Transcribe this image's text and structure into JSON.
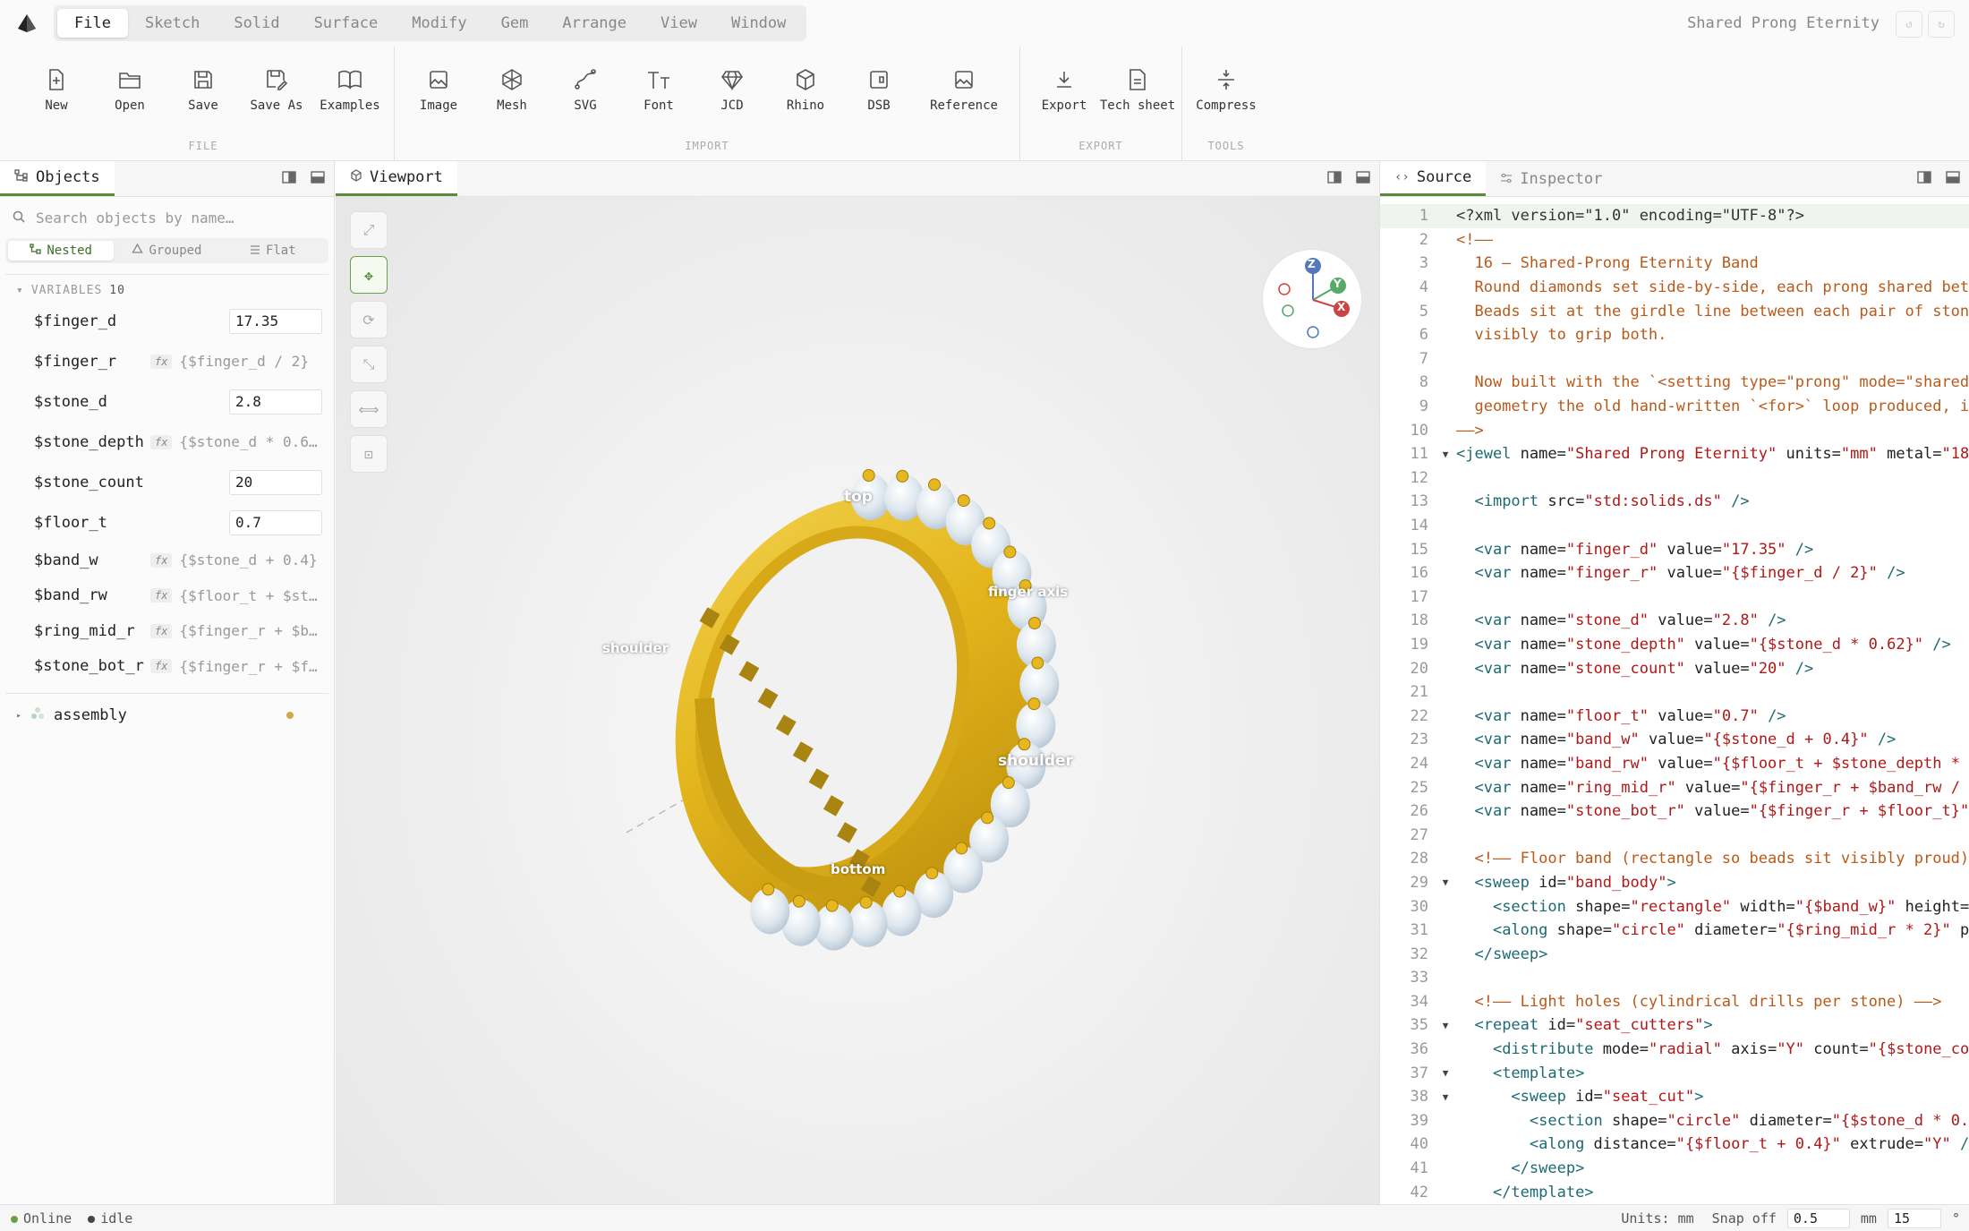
{
  "app": {
    "document_title": "Shared Prong Eternity"
  },
  "menu": [
    "File",
    "Sketch",
    "Solid",
    "Surface",
    "Modify",
    "Gem",
    "Arrange",
    "View",
    "Window"
  ],
  "ribbon": {
    "file": {
      "label": "FILE",
      "tools": [
        "New",
        "Open",
        "Save",
        "Save As",
        "Examples"
      ]
    },
    "import": {
      "label": "IMPORT",
      "tools": [
        "Image",
        "Mesh",
        "SVG",
        "Font",
        "JCD",
        "Rhino",
        "DSB",
        "Reference"
      ]
    },
    "export": {
      "label": "EXPORT",
      "tools": [
        "Export",
        "Tech sheet"
      ]
    },
    "tools": {
      "label": "TOOLS",
      "tools": [
        "Compress"
      ]
    }
  },
  "left_panel": {
    "tab": "Objects",
    "search_placeholder": "Search objects by name…",
    "view_tabs": [
      "Nested",
      "Grouped",
      "Flat"
    ],
    "variables_label": "VARIABLES",
    "variables_count": "10",
    "variables": [
      {
        "name": "$finger_d",
        "value": "17.35",
        "kind": "value"
      },
      {
        "name": "$finger_r",
        "value": "{$finger_d / 2}",
        "kind": "expr"
      },
      {
        "name": "$stone_d",
        "value": "2.8",
        "kind": "value"
      },
      {
        "name": "$stone_depth",
        "value": "{$stone_d * 0.6…",
        "kind": "expr"
      },
      {
        "name": "$stone_count",
        "value": "20",
        "kind": "value"
      },
      {
        "name": "$floor_t",
        "value": "0.7",
        "kind": "value"
      },
      {
        "name": "$band_w",
        "value": "{$stone_d + 0.4}",
        "kind": "expr"
      },
      {
        "name": "$band_rw",
        "value": "{$floor_t + $st…",
        "kind": "expr"
      },
      {
        "name": "$ring_mid_r",
        "value": "{$finger_r + $b…",
        "kind": "expr"
      },
      {
        "name": "$stone_bot_r",
        "value": "{$finger_r + $f…",
        "kind": "expr"
      }
    ],
    "tree": [
      {
        "label": "assembly"
      }
    ]
  },
  "viewport": {
    "tab": "Viewport",
    "labels": {
      "top": "top",
      "finger_axis": "finger axis",
      "shoulder_left": "shoulder",
      "shoulder_right": "shoulder",
      "bottom": "bottom"
    },
    "gizmo": {
      "z": "Z",
      "y": "Y",
      "x": "X"
    }
  },
  "right_panel": {
    "tabs": [
      "Source",
      "Inspector"
    ]
  },
  "source_lines": [
    [
      [
        "pi",
        "<?xml version=\"1.0\" encoding=\"UTF-8\"?>"
      ]
    ],
    [
      [
        "com",
        "<!——"
      ]
    ],
    [
      [
        "com",
        "  16 — Shared-Prong Eternity Band"
      ]
    ],
    [
      [
        "com",
        "  Round diamonds set side-by-side, each prong shared bet"
      ]
    ],
    [
      [
        "com",
        "  Beads sit at the girdle line between each pair of ston"
      ]
    ],
    [
      [
        "com",
        "  visibly to grip both."
      ]
    ],
    [],
    [
      [
        "com",
        "  Now built with the `<setting type=\"prong\" mode=\"shared"
      ]
    ],
    [
      [
        "com",
        "  geometry the old hand-written `<for>` loop produced, i"
      ]
    ],
    [
      [
        "com",
        "——>"
      ]
    ],
    [
      [
        "tag",
        "<jewel"
      ],
      [
        "attr",
        " name="
      ],
      [
        "str",
        "\"Shared Prong Eternity\""
      ],
      [
        "attr",
        " units="
      ],
      [
        "str",
        "\"mm\""
      ],
      [
        "attr",
        " metal="
      ],
      [
        "str",
        "\"18"
      ]
    ],
    [],
    [
      [
        "txt",
        "  "
      ],
      [
        "tag",
        "<import"
      ],
      [
        "attr",
        " src="
      ],
      [
        "str",
        "\"std:solids.ds\""
      ],
      [
        "tag",
        " />"
      ]
    ],
    [],
    [
      [
        "txt",
        "  "
      ],
      [
        "tag",
        "<var"
      ],
      [
        "attr",
        " name="
      ],
      [
        "str",
        "\"finger_d\""
      ],
      [
        "attr",
        " value="
      ],
      [
        "str",
        "\"17.35\""
      ],
      [
        "tag",
        " />"
      ]
    ],
    [
      [
        "txt",
        "  "
      ],
      [
        "tag",
        "<var"
      ],
      [
        "attr",
        " name="
      ],
      [
        "str",
        "\"finger_r\""
      ],
      [
        "attr",
        " value="
      ],
      [
        "str",
        "\"{$finger_d / 2}\""
      ],
      [
        "tag",
        " />"
      ]
    ],
    [],
    [
      [
        "txt",
        "  "
      ],
      [
        "tag",
        "<var"
      ],
      [
        "attr",
        " name="
      ],
      [
        "str",
        "\"stone_d\""
      ],
      [
        "attr",
        " value="
      ],
      [
        "str",
        "\"2.8\""
      ],
      [
        "tag",
        " />"
      ]
    ],
    [
      [
        "txt",
        "  "
      ],
      [
        "tag",
        "<var"
      ],
      [
        "attr",
        " name="
      ],
      [
        "str",
        "\"stone_depth\""
      ],
      [
        "attr",
        " value="
      ],
      [
        "str",
        "\"{$stone_d * 0.62}\""
      ],
      [
        "tag",
        " />"
      ]
    ],
    [
      [
        "txt",
        "  "
      ],
      [
        "tag",
        "<var"
      ],
      [
        "attr",
        " name="
      ],
      [
        "str",
        "\"stone_count\""
      ],
      [
        "attr",
        " value="
      ],
      [
        "str",
        "\"20\""
      ],
      [
        "tag",
        " />"
      ]
    ],
    [],
    [
      [
        "txt",
        "  "
      ],
      [
        "tag",
        "<var"
      ],
      [
        "attr",
        " name="
      ],
      [
        "str",
        "\"floor_t\""
      ],
      [
        "attr",
        " value="
      ],
      [
        "str",
        "\"0.7\""
      ],
      [
        "tag",
        " />"
      ]
    ],
    [
      [
        "txt",
        "  "
      ],
      [
        "tag",
        "<var"
      ],
      [
        "attr",
        " name="
      ],
      [
        "str",
        "\"band_w\""
      ],
      [
        "attr",
        " value="
      ],
      [
        "str",
        "\"{$stone_d + 0.4}\""
      ],
      [
        "tag",
        " />"
      ]
    ],
    [
      [
        "txt",
        "  "
      ],
      [
        "tag",
        "<var"
      ],
      [
        "attr",
        " name="
      ],
      [
        "str",
        "\"band_rw\""
      ],
      [
        "attr",
        " value="
      ],
      [
        "str",
        "\"{$floor_t + $stone_depth *"
      ]
    ],
    [
      [
        "txt",
        "  "
      ],
      [
        "tag",
        "<var"
      ],
      [
        "attr",
        " name="
      ],
      [
        "str",
        "\"ring_mid_r\""
      ],
      [
        "attr",
        " value="
      ],
      [
        "str",
        "\"{$finger_r + $band_rw /"
      ]
    ],
    [
      [
        "txt",
        "  "
      ],
      [
        "tag",
        "<var"
      ],
      [
        "attr",
        " name="
      ],
      [
        "str",
        "\"stone_bot_r\""
      ],
      [
        "attr",
        " value="
      ],
      [
        "str",
        "\"{$finger_r + $floor_t}\""
      ]
    ],
    [],
    [
      [
        "com",
        "  <!—— Floor band (rectangle so beads sit visibly proud)"
      ]
    ],
    [
      [
        "txt",
        "  "
      ],
      [
        "tag",
        "<sweep"
      ],
      [
        "attr",
        " id="
      ],
      [
        "str",
        "\"band_body\""
      ],
      [
        "tag",
        ">"
      ]
    ],
    [
      [
        "txt",
        "    "
      ],
      [
        "tag",
        "<section"
      ],
      [
        "attr",
        " shape="
      ],
      [
        "str",
        "\"rectangle\""
      ],
      [
        "attr",
        " width="
      ],
      [
        "str",
        "\"{$band_w}\""
      ],
      [
        "attr",
        " height="
      ]
    ],
    [
      [
        "txt",
        "    "
      ],
      [
        "tag",
        "<along"
      ],
      [
        "attr",
        " shape="
      ],
      [
        "str",
        "\"circle\""
      ],
      [
        "attr",
        " diameter="
      ],
      [
        "str",
        "\"{$ring_mid_r * 2}\""
      ],
      [
        "attr",
        " p"
      ]
    ],
    [
      [
        "txt",
        "  "
      ],
      [
        "tag",
        "</sweep>"
      ]
    ],
    [],
    [
      [
        "com",
        "  <!—— Light holes (cylindrical drills per stone) ——>"
      ]
    ],
    [
      [
        "txt",
        "  "
      ],
      [
        "tag",
        "<repeat"
      ],
      [
        "attr",
        " id="
      ],
      [
        "str",
        "\"seat_cutters\""
      ],
      [
        "tag",
        ">"
      ]
    ],
    [
      [
        "txt",
        "    "
      ],
      [
        "tag",
        "<distribute"
      ],
      [
        "attr",
        " mode="
      ],
      [
        "str",
        "\"radial\""
      ],
      [
        "attr",
        " axis="
      ],
      [
        "str",
        "\"Y\""
      ],
      [
        "attr",
        " count="
      ],
      [
        "str",
        "\"{$stone_co"
      ]
    ],
    [
      [
        "txt",
        "    "
      ],
      [
        "tag",
        "<template>"
      ]
    ],
    [
      [
        "txt",
        "      "
      ],
      [
        "tag",
        "<sweep"
      ],
      [
        "attr",
        " id="
      ],
      [
        "str",
        "\"seat_cut\""
      ],
      [
        "tag",
        ">"
      ]
    ],
    [
      [
        "txt",
        "        "
      ],
      [
        "tag",
        "<section"
      ],
      [
        "attr",
        " shape="
      ],
      [
        "str",
        "\"circle\""
      ],
      [
        "attr",
        " diameter="
      ],
      [
        "str",
        "\"{$stone_d * 0."
      ]
    ],
    [
      [
        "txt",
        "        "
      ],
      [
        "tag",
        "<along"
      ],
      [
        "attr",
        " distance="
      ],
      [
        "str",
        "\"{$floor_t + 0.4}\""
      ],
      [
        "attr",
        " extrude="
      ],
      [
        "str",
        "\"Y\""
      ],
      [
        "tag",
        " /"
      ]
    ],
    [
      [
        "txt",
        "      "
      ],
      [
        "tag",
        "</sweep>"
      ]
    ],
    [
      [
        "txt",
        "    "
      ],
      [
        "tag",
        "</template>"
      ]
    ]
  ],
  "fold_lines": [
    11,
    29,
    35,
    37,
    38
  ],
  "status": {
    "online": "Online",
    "state": "idle",
    "units_label": "Units: mm",
    "snap_label": "Snap off",
    "snap_value": "0.5",
    "snap_unit": "mm",
    "angle_value": "15",
    "angle_unit": "°"
  }
}
